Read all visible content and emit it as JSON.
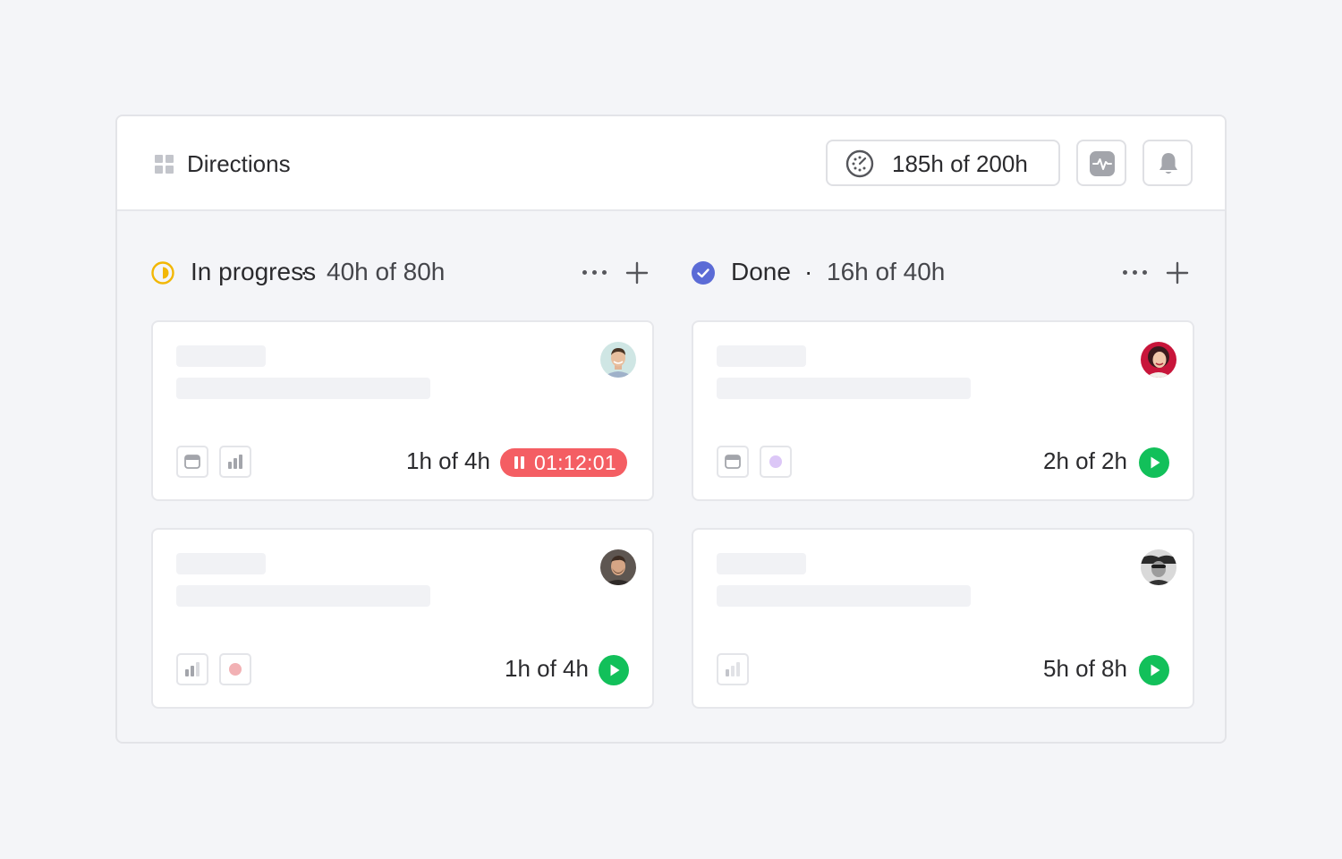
{
  "header": {
    "title": "Directions",
    "hours": "185h of 200h",
    "icons": [
      "grid-icon",
      "gauge-icon",
      "activity-icon",
      "bell-icon"
    ]
  },
  "columns": [
    {
      "status_icon": "in-progress-icon",
      "status_color": "#f2b705",
      "title": "In progress",
      "separator": "·",
      "hours": "40h of 80h",
      "cards": [
        {
          "hours": "1h of 4h",
          "timer": "01:12:01",
          "timer_running": true,
          "tags": [
            "calendar-icon",
            "chart-bars-icon"
          ]
        },
        {
          "hours": "1h of 4h",
          "timer_running": false,
          "tags": [
            "chart-bars-icon",
            "red-dot"
          ]
        }
      ]
    },
    {
      "status_icon": "done-check-icon",
      "status_color": "#5b6bd6",
      "title": "Done",
      "separator": "·",
      "hours": "16h of 40h",
      "cards": [
        {
          "hours": "2h of 2h",
          "timer_running": false,
          "tags": [
            "calendar-icon",
            "purple-dot"
          ]
        },
        {
          "hours": "5h of 8h",
          "timer_running": false,
          "tags": [
            "chart-bars-faded-icon"
          ]
        }
      ]
    }
  ],
  "colors": {
    "timer_red": "#f45e63",
    "play_green": "#12c05a",
    "purple_dot": "#dcc7f7",
    "red_dot": "#f2b1b4"
  }
}
